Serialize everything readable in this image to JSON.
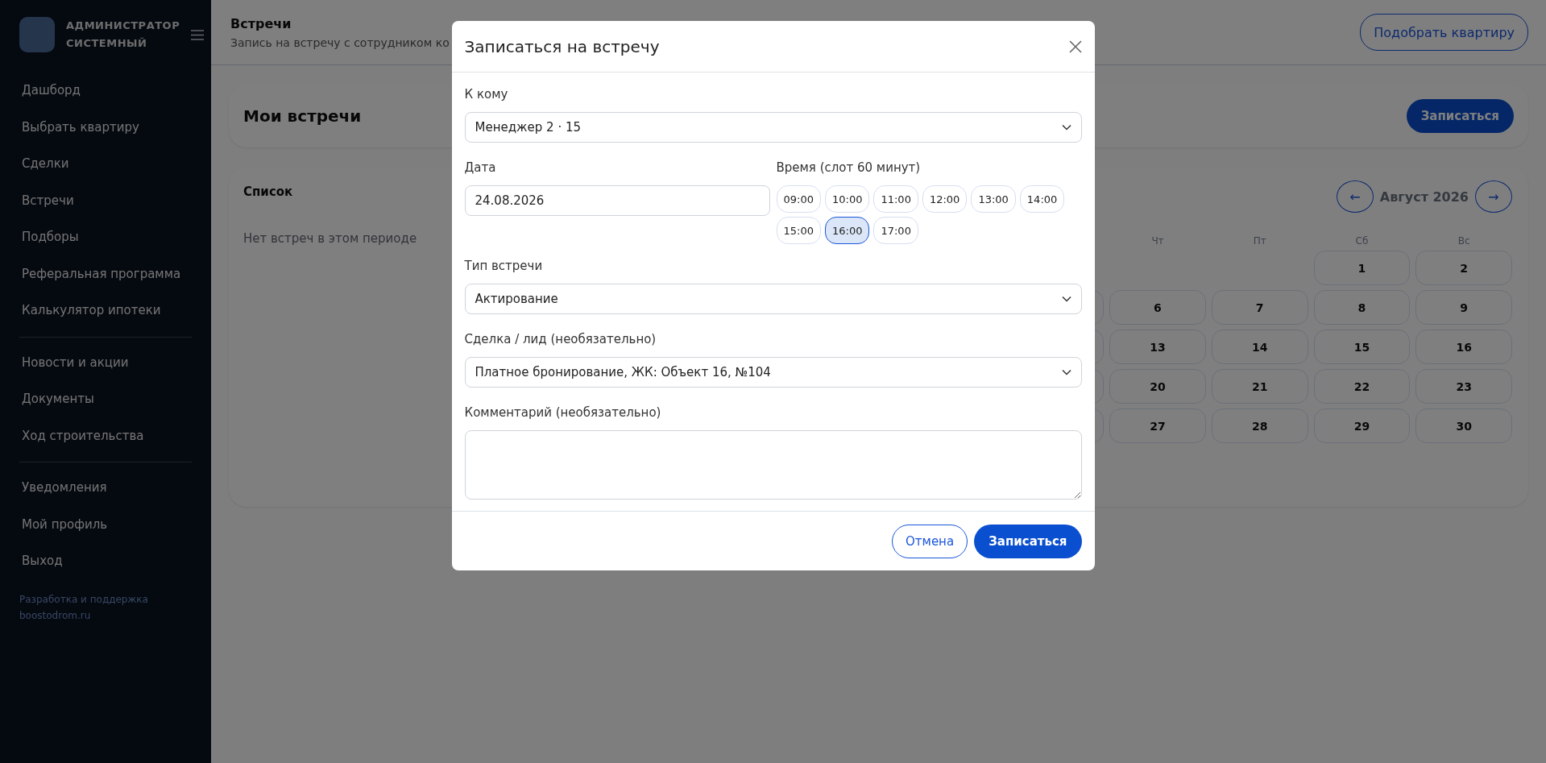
{
  "sidebar": {
    "user_name": [
      "АДМИНИСТРАТОР",
      "СИСТЕМНЫЙ"
    ],
    "groups": [
      [
        "Дашборд",
        "Выбрать квартиру",
        "Сделки",
        "Встречи",
        "Подборы",
        "Реферальная программа",
        "Калькулятор ипотеки"
      ],
      [
        "Новости и акции",
        "Документы",
        "Ход строительства"
      ],
      [
        "Уведомления",
        "Мой профиль",
        "Выход"
      ]
    ],
    "footer": [
      "Разработка и поддержка",
      "boostodrom.ru"
    ]
  },
  "header": {
    "title": "Встречи",
    "subtitle": "Запись на встречу с сотрудником ко",
    "button": "Подобрать квартиру"
  },
  "meetings_card": {
    "title": "Мои встречи",
    "button": "Записаться"
  },
  "list": {
    "title": "Список",
    "empty": "Нет встреч в этом периоде"
  },
  "calendar": {
    "prev": "←",
    "month": "Август 2026",
    "next": "→",
    "weekdays": [
      "Чт",
      "Пт",
      "Сб",
      "Вс"
    ],
    "weeks": [
      [
        "1",
        "2"
      ],
      [
        "6",
        "7",
        "8",
        "9"
      ],
      [
        "13",
        "14",
        "15",
        "16"
      ],
      [
        "20",
        "21",
        "22",
        "23"
      ],
      [
        "27",
        "28",
        "29",
        "30"
      ]
    ]
  },
  "modal": {
    "title": "Записаться на встречу",
    "to_label": "К кому",
    "to_value": "Менеджер 2 · 15",
    "date_label": "Дата",
    "date_value": "24.08.2026",
    "time_label": "Время (слот 60 минут)",
    "slots": [
      {
        "label": "09:00",
        "selected": false
      },
      {
        "label": "10:00",
        "selected": false
      },
      {
        "label": "11:00",
        "selected": false
      },
      {
        "label": "12:00",
        "selected": false
      },
      {
        "label": "13:00",
        "selected": false
      },
      {
        "label": "14:00",
        "selected": false
      },
      {
        "label": "15:00",
        "selected": false
      },
      {
        "label": "16:00",
        "selected": true
      },
      {
        "label": "17:00",
        "selected": false
      }
    ],
    "type_label": "Тип встречи",
    "type_value": "Актирование",
    "deal_label": "Сделка / лид (необязательно)",
    "deal_value": "Платное бронирование, ЖК: Объект 16, №104",
    "comment_label": "Комментарий (необязательно)",
    "cancel": "Отмена",
    "submit": "Записаться"
  }
}
